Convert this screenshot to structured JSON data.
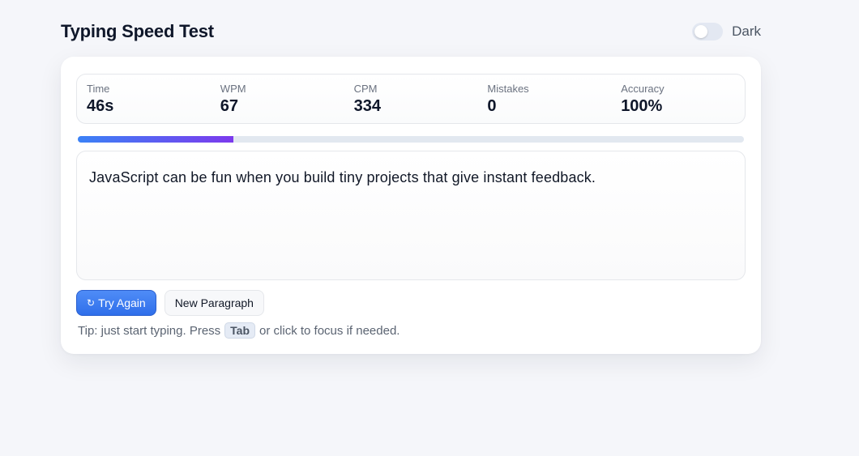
{
  "header": {
    "title": "Typing Speed Test",
    "theme_toggle_label": "Dark",
    "theme_toggle_on": false
  },
  "stats": [
    {
      "label": "Time",
      "value": "46s"
    },
    {
      "label": "WPM",
      "value": "67"
    },
    {
      "label": "CPM",
      "value": "334"
    },
    {
      "label": "Mistakes",
      "value": "0"
    },
    {
      "label": "Accuracy",
      "value": "100%"
    }
  ],
  "progress": {
    "fraction": 0.233,
    "color_start": "#3b82f6",
    "color_end": "#7c3aed"
  },
  "paragraph": "JavaScript can be fun when you build tiny projects that give instant feedback.",
  "buttons": {
    "try_again_icon": "↻",
    "try_again_label": "Try Again",
    "new_paragraph_label": "New Paragraph"
  },
  "tip": {
    "before": "Tip: just start typing. Press",
    "key": "Tab",
    "after": "or click to focus if needed."
  },
  "colors": {
    "primary": "#2f6fea",
    "background": "#f5f6fa"
  }
}
